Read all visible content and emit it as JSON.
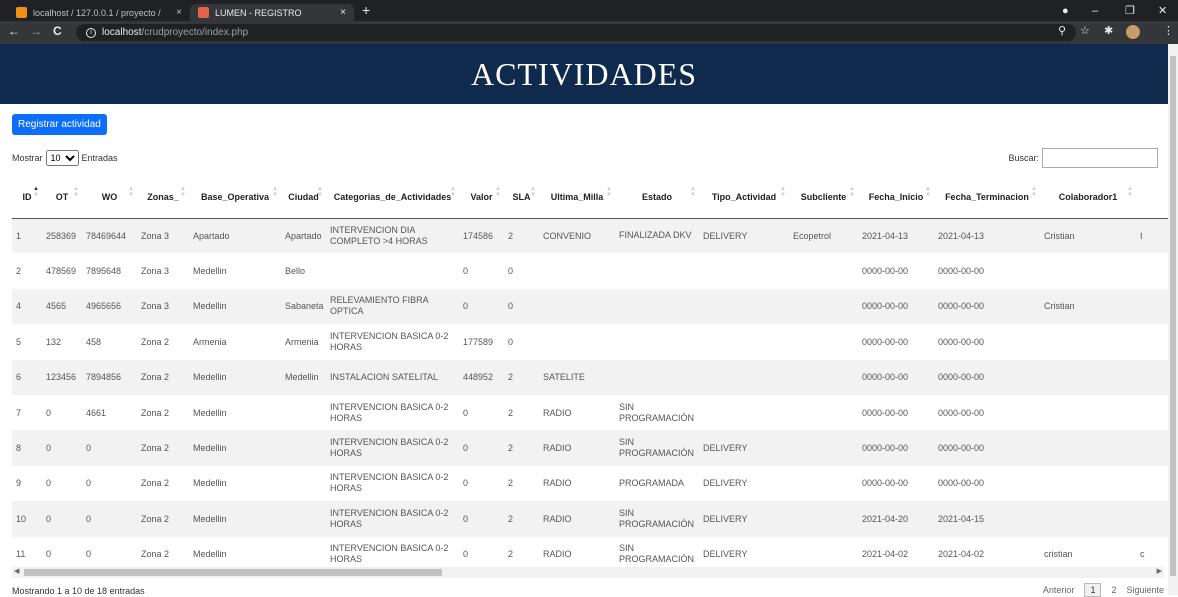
{
  "browser": {
    "tabs": [
      {
        "title": "localhost / 127.0.0.1 / proyecto /",
        "close": "×"
      },
      {
        "title": "LUMEN - REGISTRO",
        "close": "×"
      }
    ],
    "new_tab": "+",
    "window_controls": {
      "minimize": "–",
      "maximize": "❐",
      "close": "✕"
    },
    "nav": {
      "back": "←",
      "forward": "→",
      "reload": "C"
    },
    "url_host": "localhost",
    "url_path": "/crudproyecto/index.php",
    "info_icon": "i"
  },
  "page": {
    "title": "ACTIVIDADES",
    "register_button": "Registrar actividad",
    "length": {
      "before": "Mostrar",
      "value": "10",
      "after": "Entradas"
    },
    "search_label": "Buscar:",
    "columns": [
      "ID",
      "OT",
      "WO",
      "Zonas_",
      "Base_Operativa",
      "Ciudad",
      "Categorias_de_Actividades",
      "Valor",
      "SLA",
      "Ultima_Milla",
      "Estado",
      "Tipo_Actividad",
      "Subcliente",
      "Fecha_Inicio",
      "Fecha_Terminacion",
      "Colaborador1",
      ""
    ],
    "rows": [
      [
        "1",
        "258369",
        "78469644",
        "Zona 3",
        "Apartado",
        "Apartado",
        "INTERVENCION DIA COMPLETO >4 HORAS",
        "174586",
        "2",
        "CONVENIO",
        "FINALIZADA DKV",
        "DELIVERY",
        "Ecopetrol",
        "2021-04-13",
        "2021-04-13",
        "Cristian",
        "I"
      ],
      [
        "2",
        "478569",
        "7895648",
        "Zona 3",
        "Medellin",
        "Bello",
        "",
        "0",
        "0",
        "",
        "",
        "",
        "",
        "0000-00-00",
        "0000-00-00",
        "",
        ""
      ],
      [
        "4",
        "4565",
        "4965656",
        "Zona 3",
        "Medellin",
        "Sabaneta",
        "RELEVAMIENTO FIBRA OPTICA",
        "0",
        "0",
        "",
        "",
        "",
        "",
        "0000-00-00",
        "0000-00-00",
        "Cristian",
        ""
      ],
      [
        "5",
        "132",
        "458",
        "Zona 2",
        "Armenia",
        "Armenia",
        "INTERVENCION BASICA 0-2 HORAS",
        "177589",
        "0",
        "",
        "",
        "",
        "",
        "0000-00-00",
        "0000-00-00",
        "",
        ""
      ],
      [
        "6",
        "123456",
        "7894856",
        "Zona 2",
        "Medellin",
        "Medellin",
        "INSTALACION SATELITAL",
        "448952",
        "2",
        "SATELITE",
        "",
        "",
        "",
        "0000-00-00",
        "0000-00-00",
        "",
        ""
      ],
      [
        "7",
        "0",
        "4661",
        "Zona 2",
        "Medellin",
        "",
        "INTERVENCION BASICA 0-2 HORAS",
        "0",
        "2",
        "RADIO",
        "SIN PROGRAMACIÓN",
        "",
        "",
        "0000-00-00",
        "0000-00-00",
        "",
        ""
      ],
      [
        "8",
        "0",
        "0",
        "Zona 2",
        "Medellin",
        "",
        "INTERVENCION BASICA 0-2 HORAS",
        "0",
        "2",
        "RADIO",
        "SIN PROGRAMACIÓN",
        "DELIVERY",
        "",
        "0000-00-00",
        "0000-00-00",
        "",
        ""
      ],
      [
        "9",
        "0",
        "0",
        "Zona 2",
        "Medellin",
        "",
        "INTERVENCION BASICA 0-2 HORAS",
        "0",
        "2",
        "RADIO",
        "PROGRAMADA",
        "DELIVERY",
        "",
        "0000-00-00",
        "0000-00-00",
        "",
        ""
      ],
      [
        "10",
        "0",
        "0",
        "Zona 2",
        "Medellin",
        "",
        "INTERVENCION BASICA 0-2 HORAS",
        "0",
        "2",
        "RADIO",
        "SIN PROGRAMACIÓN",
        "DELIVERY",
        "",
        "2021-04-20",
        "2021-04-15",
        "",
        ""
      ],
      [
        "11",
        "0",
        "0",
        "Zona 2",
        "Medellin",
        "",
        "INTERVENCION BASICA 0-2 HORAS",
        "0",
        "2",
        "RADIO",
        "SIN PROGRAMACIÓN",
        "DELIVERY",
        "",
        "2021-04-02",
        "2021-04-02",
        "cristian",
        "c"
      ]
    ],
    "info": "Mostrando 1 a 10 de 18 entradas",
    "pager": {
      "prev": "Anterior",
      "pages": [
        "1",
        "2"
      ],
      "next": "Siguiente"
    }
  },
  "colors": {
    "banner": "#102a4e",
    "primary_button": "#0d6efd",
    "browser_dark": "#202124"
  }
}
